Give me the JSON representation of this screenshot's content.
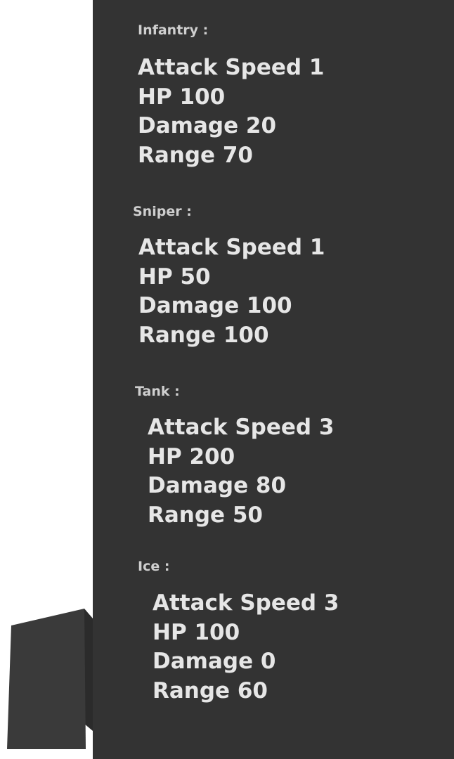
{
  "units": [
    {
      "title": "Infantry :",
      "stats": [
        "Attack Speed 1",
        "HP 100",
        "Damage 20",
        "Range 70"
      ]
    },
    {
      "title": "Sniper :",
      "stats": [
        "Attack Speed 1",
        "HP 50",
        "Damage 100",
        "Range 100"
      ]
    },
    {
      "title": "Tank :",
      "stats": [
        "Attack Speed 3",
        "HP 200",
        "Damage 80",
        "Range 50"
      ]
    },
    {
      "title": "Ice :",
      "stats": [
        "Attack Speed 3",
        "HP 100",
        "Damage 0",
        "Range 60"
      ]
    }
  ],
  "colors": {
    "panel_bg": "#333333",
    "text": "#e6e6e6",
    "cube_front": "#3a3a3a",
    "cube_side": "#2b2b2b"
  }
}
